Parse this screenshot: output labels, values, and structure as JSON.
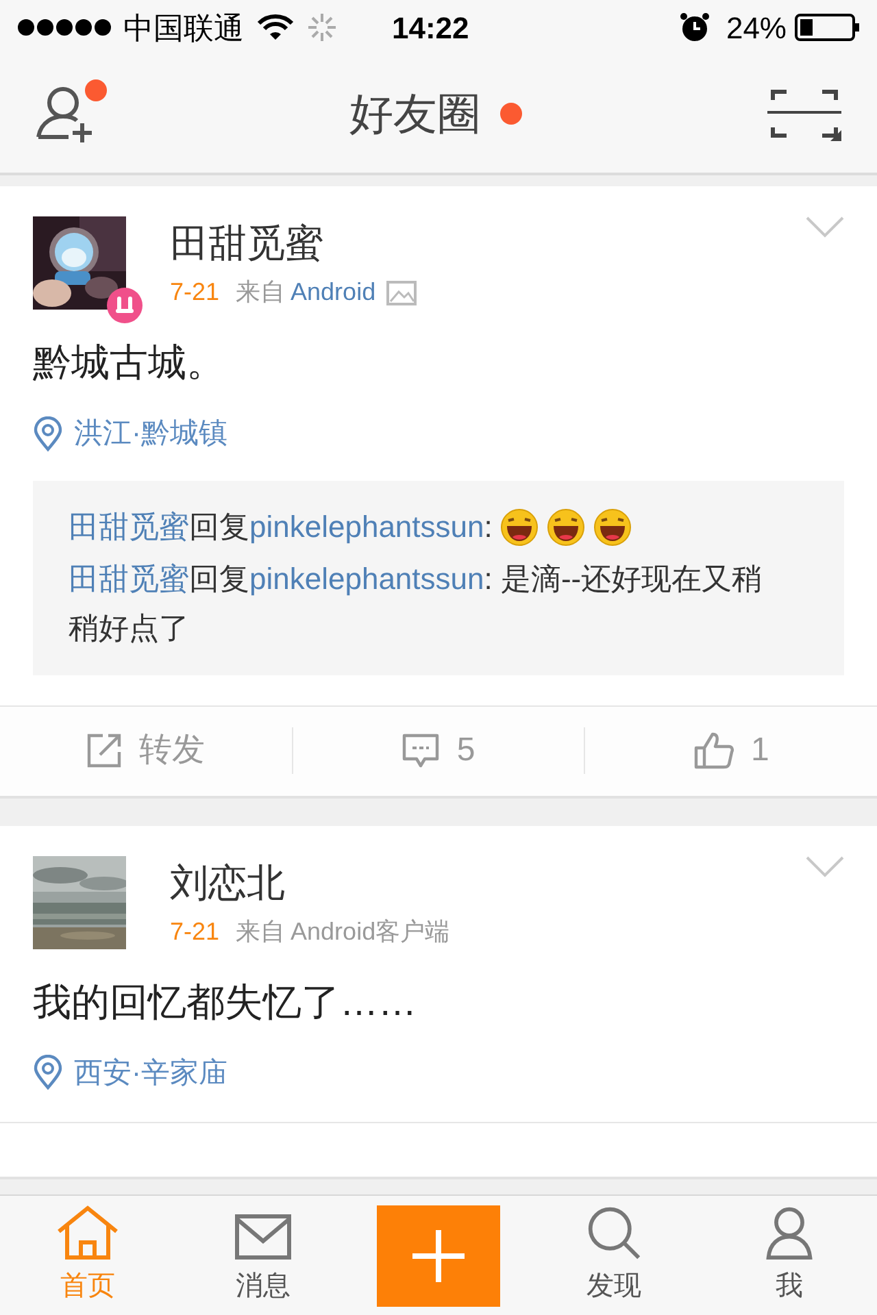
{
  "status_bar": {
    "carrier": "中国联通",
    "time": "14:22",
    "battery": "24%"
  },
  "nav": {
    "title": "好友圈",
    "title_badge": true,
    "add_friend_badge": true
  },
  "posts": [
    {
      "author": "田甜觅蜜",
      "member_badge": true,
      "date": "7-21",
      "source_prefix": "来自",
      "source": "Android",
      "source_linked": true,
      "has_image": true,
      "text": "黔城古城。",
      "location": "洪江·黔城镇",
      "replies": [
        {
          "user": "田甜觅蜜",
          "verb": "回复",
          "target": "pinkelephantssun",
          "text": ": ",
          "emojis": [
            {
              "kind": "laugh"
            },
            {
              "kind": "laugh"
            },
            {
              "kind": "laugh"
            }
          ]
        },
        {
          "user": "田甜觅蜜",
          "verb": "回复",
          "target": "pinkelephantssun",
          "text": ": 是滴--还好现在又稍稍好点了"
        }
      ],
      "actions": [
        {
          "kind": "repost",
          "label": "转发"
        },
        {
          "kind": "comment",
          "label": "5"
        },
        {
          "kind": "like",
          "label": "1"
        }
      ]
    },
    {
      "author": "刘恋北",
      "member_badge": false,
      "date": "7-21",
      "source_prefix": "来自",
      "source": "Android客户端",
      "source_linked": false,
      "has_image": false,
      "text": "我的回忆都失忆了……",
      "location": "西安·辛家庙"
    }
  ],
  "tab_bar": [
    {
      "kind": "home",
      "label": "首页",
      "selected": true
    },
    {
      "kind": "messages",
      "label": "消息",
      "selected": false
    },
    {
      "kind": "compose",
      "selected": false
    },
    {
      "kind": "discover",
      "label": "发现",
      "selected": false
    },
    {
      "kind": "me",
      "label": "我",
      "selected": false
    }
  ]
}
